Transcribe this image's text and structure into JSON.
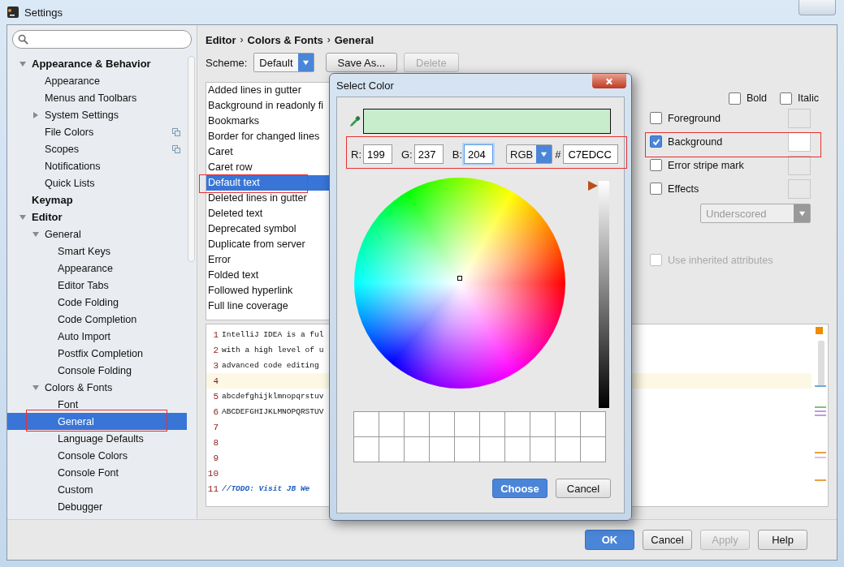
{
  "window": {
    "title": "Settings"
  },
  "sidebar": {
    "tree": [
      {
        "label": "Appearance & Behavior",
        "expanded": true,
        "selected": false,
        "children": [
          {
            "label": "Appearance",
            "selected": false
          },
          {
            "label": "Menus and Toolbars",
            "selected": false
          },
          {
            "label": "System Settings",
            "expanded": false,
            "selected": false
          },
          {
            "label": "File Colors",
            "selected": false,
            "copy_icon": true
          },
          {
            "label": "Scopes",
            "selected": false,
            "copy_icon": true
          },
          {
            "label": "Notifications",
            "selected": false
          },
          {
            "label": "Quick Lists",
            "selected": false
          }
        ]
      },
      {
        "label": "Keymap",
        "selected": false
      },
      {
        "label": "Editor",
        "expanded": true,
        "selected": false,
        "children": [
          {
            "label": "General",
            "expanded": true,
            "selected": false,
            "children": [
              {
                "label": "Smart Keys",
                "selected": false
              },
              {
                "label": "Appearance",
                "selected": false
              },
              {
                "label": "Editor Tabs",
                "selected": false
              },
              {
                "label": "Code Folding",
                "selected": false
              },
              {
                "label": "Code Completion",
                "selected": false
              },
              {
                "label": "Auto Import",
                "selected": false
              },
              {
                "label": "Postfix Completion",
                "selected": false
              },
              {
                "label": "Console Folding",
                "selected": false
              }
            ]
          },
          {
            "label": "Colors & Fonts",
            "expanded": true,
            "selected": false,
            "children": [
              {
                "label": "Font",
                "selected": false
              },
              {
                "label": "General",
                "selected": true
              },
              {
                "label": "Language Defaults",
                "selected": false
              },
              {
                "label": "Console Colors",
                "selected": false
              },
              {
                "label": "Console Font",
                "selected": false
              },
              {
                "label": "Custom",
                "selected": false
              },
              {
                "label": "Debugger",
                "selected": false
              }
            ]
          }
        ]
      }
    ]
  },
  "breadcrumb": [
    {
      "kind": "crumb",
      "text": "Editor"
    },
    {
      "kind": "sep",
      "text": "›"
    },
    {
      "kind": "crumb",
      "text": "Colors & Fonts"
    },
    {
      "kind": "sep",
      "text": "›"
    },
    {
      "kind": "crumb",
      "text": "General"
    }
  ],
  "scheme": {
    "label": "Scheme:",
    "value": "Default"
  },
  "scheme_buttons": [
    {
      "label": "Save As...",
      "disabled": false
    },
    {
      "label": "Delete",
      "disabled": true
    }
  ],
  "elements": [
    {
      "label": "Added lines in gutter",
      "selected": false
    },
    {
      "label": "Background in readonly fi",
      "selected": false
    },
    {
      "label": "Bookmarks",
      "selected": false
    },
    {
      "label": "Border for changed lines",
      "selected": false
    },
    {
      "label": "Caret",
      "selected": false
    },
    {
      "label": "Caret row",
      "selected": false
    },
    {
      "label": "Default text",
      "selected": true
    },
    {
      "label": "Deleted lines in gutter",
      "selected": false
    },
    {
      "label": "Deleted text",
      "selected": false
    },
    {
      "label": "Deprecated symbol",
      "selected": false
    },
    {
      "label": "Duplicate from server",
      "selected": false
    },
    {
      "label": "Error",
      "selected": false
    },
    {
      "label": "Folded text",
      "selected": false
    },
    {
      "label": "Followed hyperlink",
      "selected": false
    },
    {
      "label": "Full line coverage",
      "selected": false
    }
  ],
  "attributes": {
    "styles": [
      {
        "label": "Bold",
        "checked": false
      },
      {
        "label": "Italic",
        "checked": false
      }
    ],
    "colors": [
      {
        "label": "Foreground",
        "checked": false
      },
      {
        "label": "Background",
        "checked": true
      },
      {
        "label": "Error stripe mark",
        "checked": false
      },
      {
        "label": "Effects",
        "checked": false
      }
    ],
    "effect_type": {
      "value": "Underscored",
      "disabled": true
    },
    "inherit": {
      "label": "Use inherited attributes",
      "checked": false,
      "disabled": true
    }
  },
  "preview_lines": [
    {
      "number": "1",
      "kind": "code",
      "current": false,
      "text": "IntelliJ IDEA is a ful"
    },
    {
      "number": "2",
      "kind": "code",
      "current": false,
      "text": "with a high level of u"
    },
    {
      "number": "3",
      "kind": "code",
      "current": false,
      "text": "advanced code editing"
    },
    {
      "number": "4",
      "current": true
    },
    {
      "number": "5",
      "kind": "code",
      "current": false,
      "text": "abcdefghijklmnopqrstuv"
    },
    {
      "number": "6",
      "kind": "code",
      "current": false,
      "text": "ABCDEFGHIJKLMNOPQRSTUV"
    },
    {
      "number": "7",
      "current": false
    },
    {
      "number": "8",
      "current": false
    },
    {
      "number": "9",
      "current": false
    },
    {
      "number": "10",
      "current": false
    },
    {
      "number": "11",
      "kind": "comment",
      "current": false,
      "text": "//TODO: Visit JB We"
    }
  ],
  "color_dialog": {
    "title": "Select Color",
    "preview": {
      "color": "#c7edcc"
    },
    "channels": [
      {
        "label": "R:",
        "value": "199",
        "focused": false
      },
      {
        "label": "G:",
        "value": "237",
        "focused": false
      },
      {
        "label": "B:",
        "value": "204",
        "focused": true
      }
    ],
    "mode": "RGB",
    "hash": "#",
    "hex": "C7EDCC",
    "brightness": {
      "level": 1
    },
    "buttons": [
      {
        "label": "Choose",
        "primary": true
      },
      {
        "label": "Cancel",
        "primary": false
      }
    ]
  },
  "footer_buttons": [
    {
      "label": "OK",
      "primary": true,
      "disabled": false
    },
    {
      "label": "Cancel",
      "primary": false,
      "disabled": false
    },
    {
      "label": "Apply",
      "primary": false,
      "disabled": true
    },
    {
      "label": "Help",
      "primary": false,
      "disabled": false
    }
  ]
}
